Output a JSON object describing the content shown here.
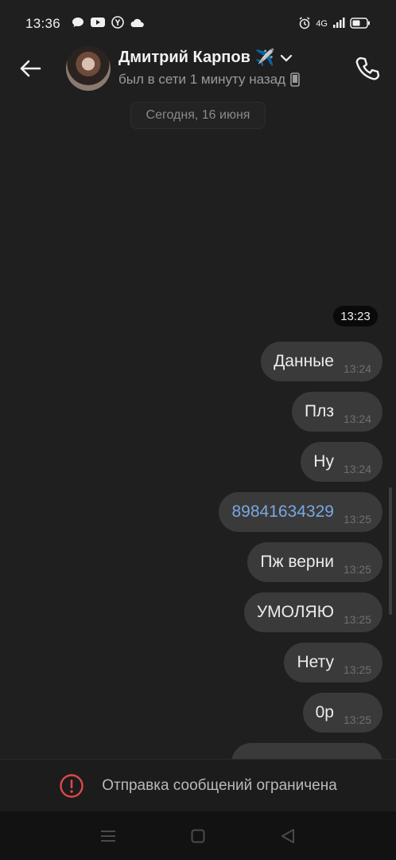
{
  "status_bar": {
    "time": "13:36",
    "network": "4G",
    "icons": [
      "message-icon",
      "youtube-icon",
      "yandex-icon",
      "cloud-icon",
      "alarm-icon",
      "signal-icon",
      "battery-icon"
    ]
  },
  "header": {
    "contact_name": "Дмитрий Карпов",
    "name_emoji": "✈️",
    "status": "был в сети 1 минуту назад"
  },
  "date_label": "Сегодня, 16 июня",
  "time_marker": "13:23",
  "messages": [
    {
      "text": "Данные",
      "time": "13:24"
    },
    {
      "text": "Плз",
      "time": "13:24"
    },
    {
      "text": "Ну",
      "time": "13:24"
    },
    {
      "text": "89841634329",
      "time": "13:25"
    },
    {
      "text": "Пж верни",
      "time": "13:25"
    },
    {
      "text": "УМОЛЯЮ",
      "time": "13:25"
    },
    {
      "text": "Нету",
      "time": "13:25"
    },
    {
      "text": "0р",
      "time": "13:25"
    }
  ],
  "restricted_text": "Отправка сообщений ограничена",
  "colors": {
    "background": "#1f1f1f",
    "bubble": "#3a3a3a",
    "link": "#7aa7e0",
    "warning": "#e04848"
  }
}
